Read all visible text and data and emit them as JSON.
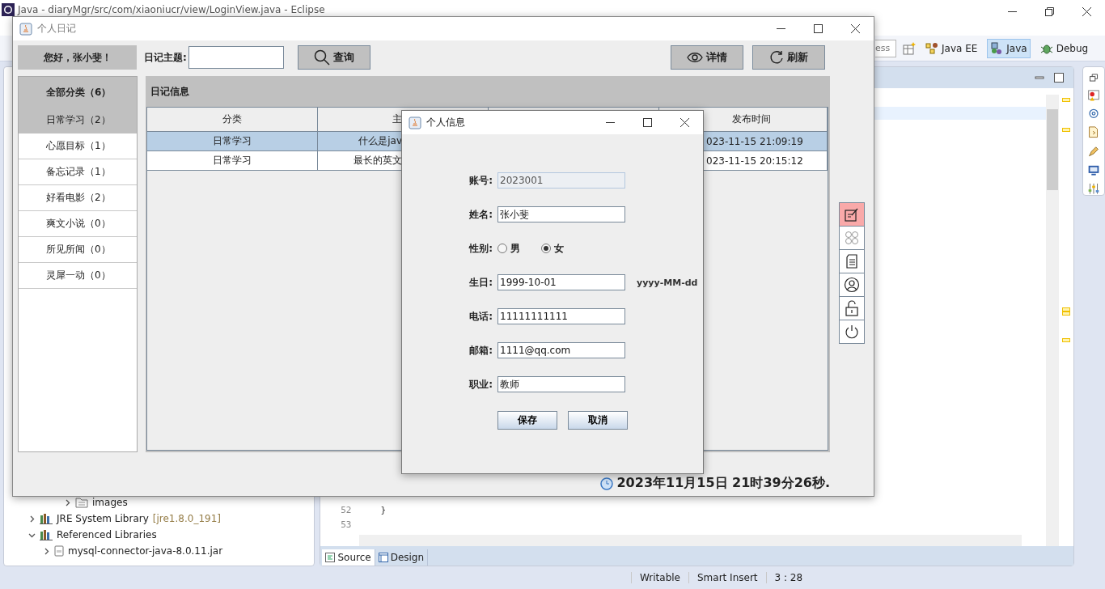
{
  "ide": {
    "title": "Java - diaryMgr/src/com/xiaoniucr/view/LoginView.java - Eclipse",
    "quick_access": "ess",
    "perspectives": [
      {
        "label": "Java EE",
        "selected": false,
        "kind": "javaee"
      },
      {
        "label": "Java",
        "selected": true,
        "kind": "java"
      },
      {
        "label": "Debug",
        "selected": false,
        "kind": "debug"
      }
    ],
    "tree": [
      {
        "kind": "folder",
        "label": "images",
        "expanded": false
      },
      {
        "kind": "library",
        "label": "JRE System Library",
        "suffix": "[jre1.8.0_191]",
        "expanded": false
      },
      {
        "kind": "library",
        "label": "Referenced Libraries",
        "expanded": true,
        "children": [
          {
            "kind": "jar",
            "label": "mysql-connector-java-8.0.11.jar",
            "expanded": false
          }
        ]
      }
    ],
    "code_lines": [
      {
        "number": "52",
        "text": "}"
      },
      {
        "number": "53"
      }
    ],
    "editor_tabs": [
      {
        "label": "Source",
        "selected": true,
        "kind": "source"
      },
      {
        "label": "Design",
        "selected": false,
        "kind": "design"
      }
    ],
    "status_bar": [
      "Writable",
      "Smart Insert",
      "3 : 28"
    ]
  },
  "app": {
    "title": "个人日记",
    "greeting": "您好，张小斐！",
    "search_label": "日记主题:",
    "buttons": [
      {
        "label": "查询",
        "kind": "search"
      },
      {
        "label": "详情",
        "kind": "view"
      },
      {
        "label": "刷新",
        "kind": "refresh"
      }
    ],
    "categories": {
      "header": "全部分类（6）",
      "items": [
        {
          "label": "日常学习（2）",
          "selected": true
        },
        {
          "label": "心愿目标（1）",
          "selected": false
        },
        {
          "label": "备忘记录（1）",
          "selected": false
        },
        {
          "label": "好看电影（2）",
          "selected": false
        },
        {
          "label": "爽文小说（0）",
          "selected": false
        },
        {
          "label": "所见所闻（0）",
          "selected": false
        },
        {
          "label": "灵犀一动（0）",
          "selected": false
        }
      ]
    },
    "panel_title": "日记信息",
    "table": {
      "columns": {
        "category": "分类",
        "title": "主",
        "time": "发布时间"
      },
      "rows": [
        {
          "category": "日常学习",
          "title": "什么是jav",
          "time": "023-11-15 21:09:19",
          "selected": true
        },
        {
          "category": "日常学习",
          "title": "最长的英文",
          "time": "023-11-15 20:15:12",
          "selected": false
        }
      ]
    },
    "tools": [
      {
        "kind": "edit",
        "selected": true
      },
      {
        "kind": "clover",
        "selected": false
      },
      {
        "kind": "document",
        "selected": false
      },
      {
        "kind": "user",
        "selected": false
      },
      {
        "kind": "lock",
        "selected": false
      },
      {
        "kind": "power",
        "selected": false
      }
    ],
    "clock": "2023年11月15日 21时39分26秒."
  },
  "dialog": {
    "title": "个人信息",
    "fields": [
      {
        "kind": "text",
        "label": "账号:",
        "value": "2023001",
        "disabled": true
      },
      {
        "kind": "text",
        "label": "姓名:",
        "value": "张小斐",
        "disabled": false
      },
      {
        "kind": "radio",
        "label": "性别:",
        "options": [
          {
            "label": "男",
            "selected": false
          },
          {
            "label": "女",
            "selected": true
          }
        ]
      },
      {
        "kind": "text",
        "label": "生日:",
        "value": "1999-10-01",
        "disabled": false,
        "hint": "yyyy-MM-dd"
      },
      {
        "kind": "text",
        "label": "电话:",
        "value": "11111111111",
        "disabled": false
      },
      {
        "kind": "text",
        "label": "邮箱:",
        "value": "1111@qq.com",
        "disabled": false
      },
      {
        "kind": "text",
        "label": "职业:",
        "value": "教师",
        "disabled": false
      }
    ],
    "buttons": [
      "保存",
      "取消"
    ]
  }
}
